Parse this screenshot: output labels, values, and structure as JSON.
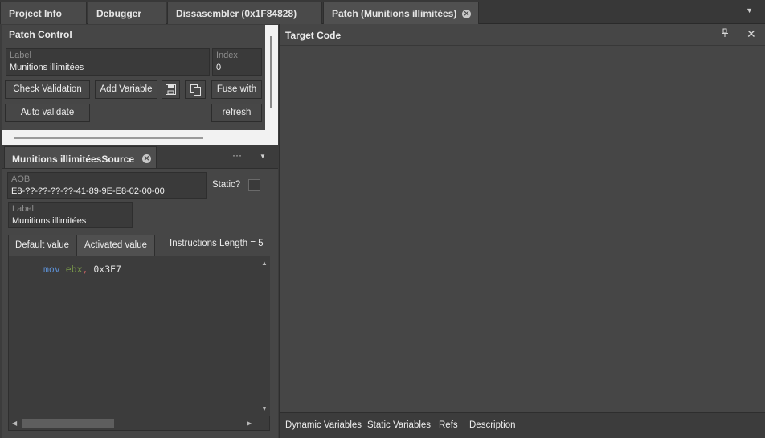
{
  "document_tabs": [
    {
      "label": "Project Info"
    },
    {
      "label": "Debugger"
    },
    {
      "label": "Dissasembler (0x1F84828)"
    },
    {
      "label": "Patch (Munitions illimitées)",
      "active": true,
      "closable": true
    }
  ],
  "patch_control": {
    "title": "Patch Control",
    "label_field": {
      "label": "Label",
      "value": "Munitions illimitées"
    },
    "index_field": {
      "label": "Index",
      "value": "0"
    },
    "buttons": {
      "check_validation": "Check Validation",
      "add_variable": "Add Variable",
      "save_icon": "floppy-disk-icon",
      "copy_icon": "copy-pages-icon",
      "fuse_with": "Fuse with",
      "auto_validate": "Auto validate",
      "refresh": "refresh"
    }
  },
  "source": {
    "tab_label": "Munitions illimitéesSource",
    "menu_ellipsis": "···",
    "aob_field": {
      "label": "AOB",
      "value": "E8-??-??-??-??-41-89-9E-E8-02-00-00"
    },
    "static_label": "Static?",
    "static_checked": false,
    "label_field": {
      "label": "Label",
      "value": "Munitions illimitées"
    },
    "value_tabs": [
      {
        "label": "Default value"
      },
      {
        "label": "Activated value",
        "active": true
      }
    ],
    "instructions_length": "Instructions Length = 5",
    "code": {
      "mnemonic": "mov",
      "register": "ebx",
      "separator": ",",
      "operand": " 0x3E7"
    }
  },
  "target_code": {
    "title": "Target Code",
    "pin_icon": "pin-icon",
    "close_icon": "close-icon",
    "bottom_tabs": [
      {
        "label": "Dynamic Variables"
      },
      {
        "label": "Static Variables"
      },
      {
        "label": "Refs"
      },
      {
        "label": "Description"
      }
    ]
  },
  "colors": {
    "background": "#3c3c3c",
    "panel": "#464646",
    "mnemonic": "#5d8fd2",
    "register": "#7a9a4a",
    "separator": "#c06060"
  }
}
